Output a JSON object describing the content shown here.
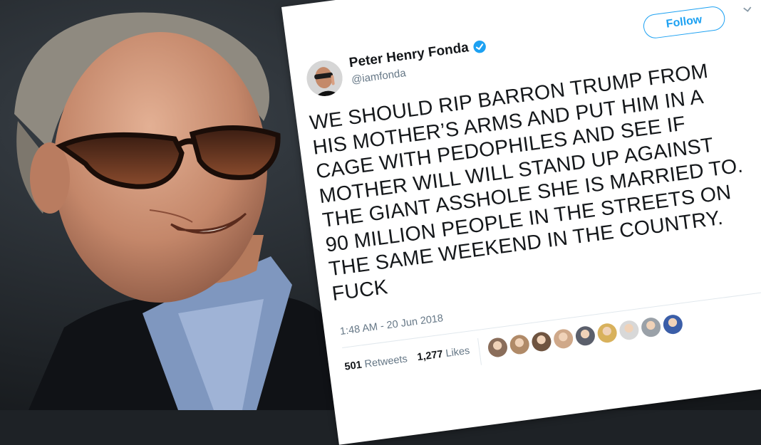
{
  "tweet": {
    "display_name": "Peter Henry Fonda",
    "handle": "@iamfonda",
    "follow_label": "Follow",
    "text_lines": [
      "WE SHOULD RIP BARRON TRUMP FROM",
      "HIS MOTHER’S ARMS AND PUT HIM IN A",
      "CAGE WITH PEDOPHILES AND SEE IF",
      "MOTHER WILL WILL STAND UP AGAINST",
      "THE GIANT ASSHOLE SHE IS MARRIED TO.",
      "90 MILLION PEOPLE IN THE STREETS ON",
      "THE SAME WEEKEND IN THE COUNTRY.",
      "FUCK"
    ],
    "timestamp": "1:48 AM - 20 Jun 2018",
    "retweets_count": "501",
    "retweets_label": "Retweets",
    "likes_count": "1,277",
    "likes_label": "Likes",
    "liker_colors": [
      "#8a6d5a",
      "#b08a68",
      "#6f5440",
      "#cfa889",
      "#5b5f6b",
      "#d8b15c",
      "#d8d8d8",
      "#9aa1a8",
      "#3b5ea8"
    ]
  },
  "colors": {
    "accent": "#1da1f2",
    "text": "#14171a",
    "secondary": "#657786"
  }
}
